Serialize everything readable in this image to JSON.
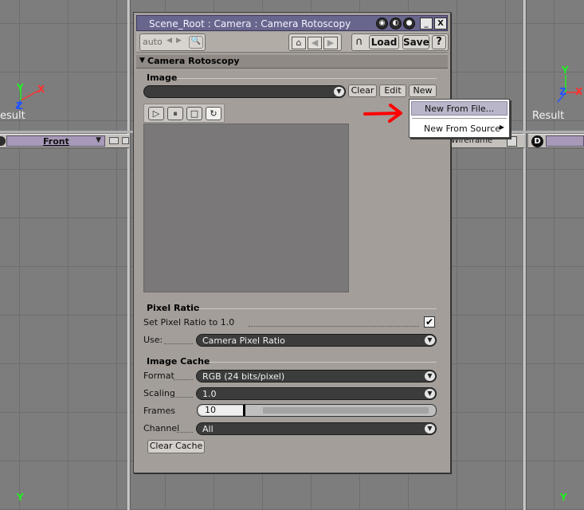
{
  "window": {
    "title": "Scene_Root : Camera : Camera Rotoscopy",
    "title_buttons": [
      "_",
      "X"
    ]
  },
  "toolbar": {
    "auto_label": "auto",
    "load_label": "Load",
    "save_label": "Save",
    "help_label": "?"
  },
  "section": {
    "title": "Camera Rotoscopy"
  },
  "image_group": {
    "title": "Image",
    "clear_label": "Clear",
    "edit_label": "Edit",
    "new_label": "New"
  },
  "context_menu": {
    "items": [
      "New From File...",
      "New From Source"
    ]
  },
  "pixel_ratio": {
    "title": "Pixel Ratio",
    "set_label": "Set Pixel Ratio to 1.0",
    "set_checked": true,
    "check_glyph": "✔",
    "use_label": "Use:",
    "use_value": "Camera Pixel Ratio"
  },
  "image_cache": {
    "title": "Image Cache",
    "format_label": "Format",
    "format_value": "RGB (24 bits/pixel)",
    "scaling_label": "Scaling",
    "scaling_value": "1.0",
    "frames_label": "Frames",
    "frames_value": "10",
    "channel_label": "Channel",
    "channel_value": "All",
    "clear_cache_label": "Clear Cache"
  },
  "viewports": {
    "left_result": "esult",
    "right_result": "Result",
    "front_label": "Front",
    "wireframe_label": "Wireframe",
    "d_badge": "D"
  },
  "axes": {
    "x": "X",
    "y": "Y",
    "z": "Z"
  },
  "colors": {
    "title_bar": "#69668e",
    "arrow": "#ff0000",
    "axis_x": "#ff3030",
    "axis_y": "#22ee22",
    "axis_z": "#2255ff"
  }
}
